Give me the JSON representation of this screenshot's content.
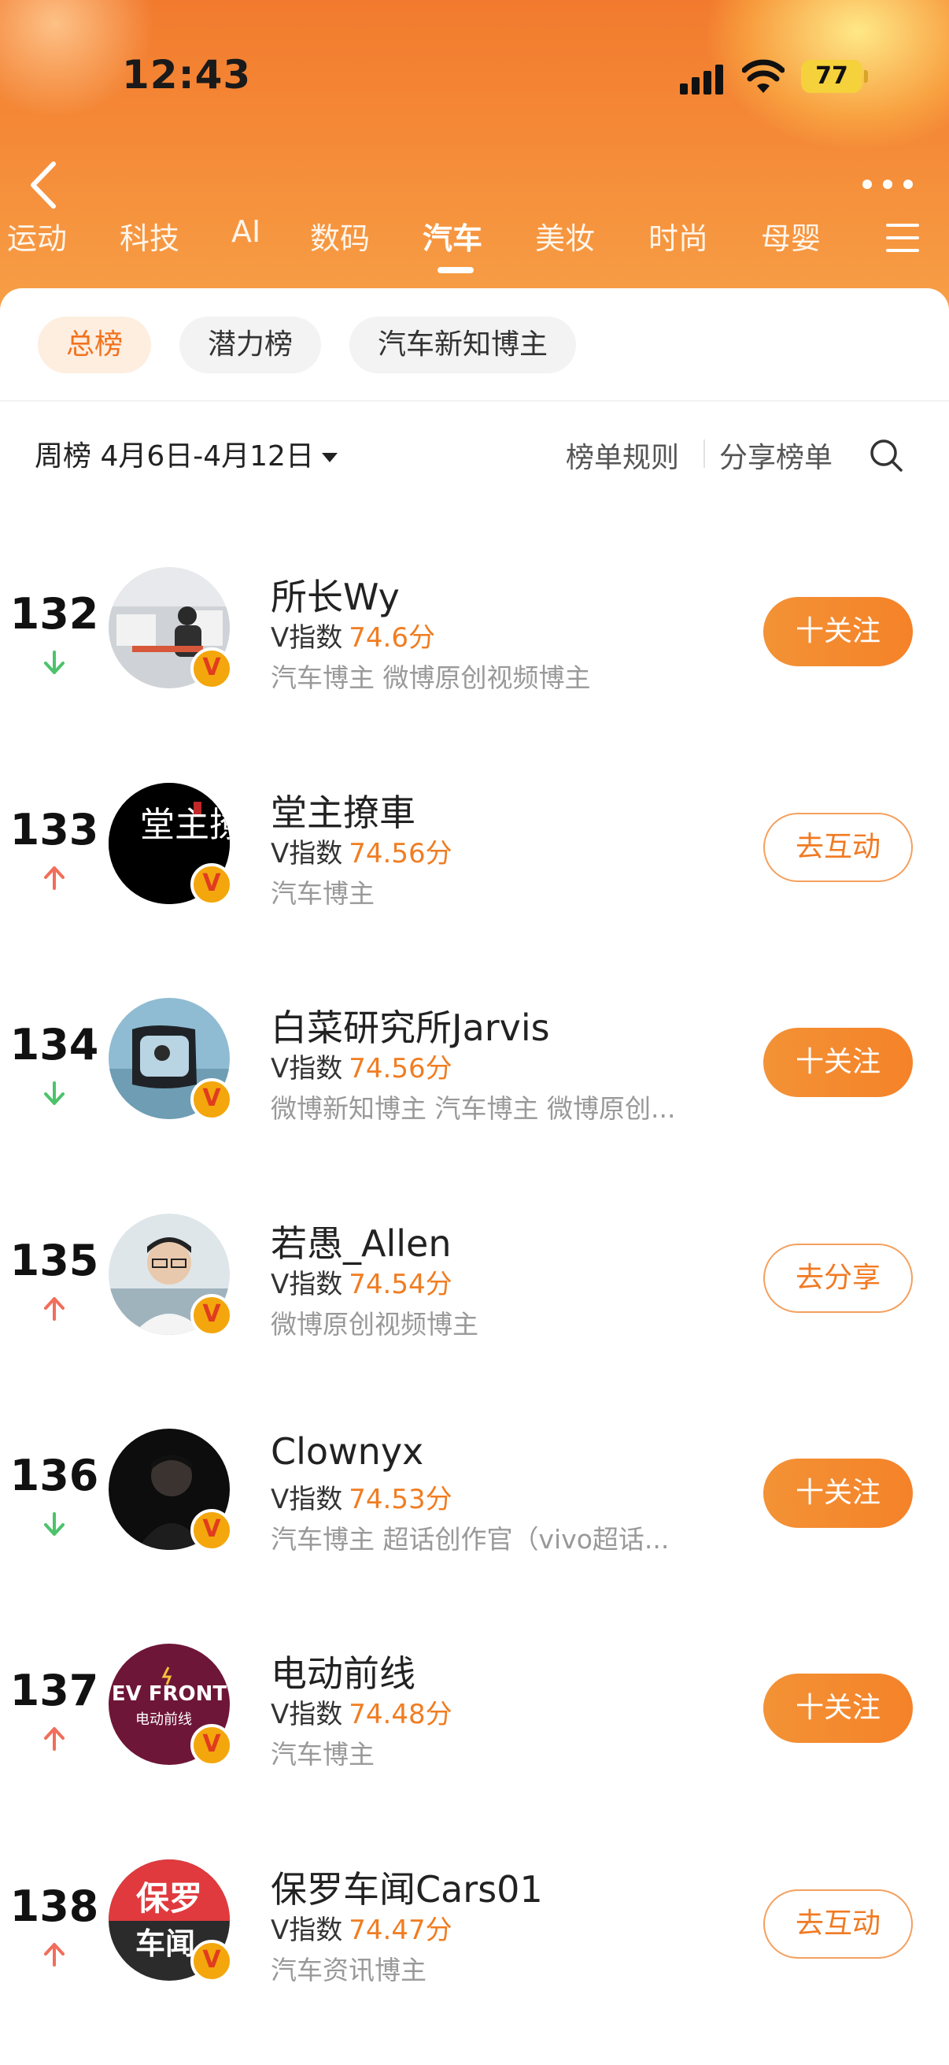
{
  "status": {
    "time": "12:43",
    "battery": "77"
  },
  "categories": [
    "运动",
    "科技",
    "AI",
    "数码",
    "汽车",
    "美妆",
    "时尚",
    "母婴"
  ],
  "active_category": "汽车",
  "chips": [
    "总榜",
    "潜力榜",
    "汽车新知博主"
  ],
  "period": "周榜 4月6日-4月12日",
  "rules_label": "榜单规则",
  "share_label": "分享榜单",
  "score_prefix": "V指数",
  "rows": [
    {
      "rank": "132",
      "trend": "down",
      "name": "所长Wy",
      "score": "74.6分",
      "tags": "汽车博主 微博原创视频博主",
      "action": "十关注"
    },
    {
      "rank": "133",
      "trend": "up",
      "name": "堂主撩車",
      "score": "74.56分",
      "tags": "汽车博主",
      "action": "去互动"
    },
    {
      "rank": "134",
      "trend": "down",
      "name": "白菜研究所Jarvis",
      "score": "74.56分",
      "tags": "微博新知博主 汽车博主 微博原创...",
      "action": "十关注"
    },
    {
      "rank": "135",
      "trend": "up",
      "name": "若愚_Allen",
      "score": "74.54分",
      "tags": "微博原创视频博主",
      "action": "去分享"
    },
    {
      "rank": "136",
      "trend": "down",
      "name": "Clownyx",
      "score": "74.53分",
      "tags": "汽车博主 超话创作官（vivo超话...",
      "action": "十关注"
    },
    {
      "rank": "137",
      "trend": "up",
      "name": "电动前线",
      "score": "74.48分",
      "tags": "汽车博主",
      "action": "十关注"
    },
    {
      "rank": "138",
      "trend": "up",
      "name": "保罗车闻Cars01",
      "score": "74.47分",
      "tags": "汽车资讯博主",
      "action": "去互动"
    }
  ],
  "avatars": {
    "a133": "堂主撩車",
    "a137_top": "EV FRONT",
    "a137_bottom": "电动前线",
    "a138_top": "保罗",
    "a138_bottom": "车闻"
  },
  "colors": {
    "accent": "#f07d22",
    "up": "#f26d5b",
    "down": "#4cc36b"
  }
}
